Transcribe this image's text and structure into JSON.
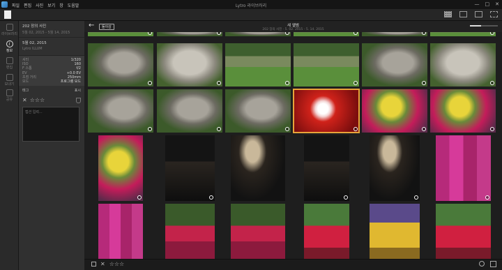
{
  "app": {
    "title": "Lytro 라이브러리",
    "menus": [
      "파일",
      "편집",
      "사진",
      "보기",
      "창",
      "도움말"
    ],
    "window_controls": [
      "—",
      "□",
      "✕"
    ]
  },
  "sidebar": {
    "tabs": [
      {
        "label": "라이브러리"
      },
      {
        "label": "정보"
      },
      {
        "label": "편집"
      },
      {
        "label": "보내기"
      },
      {
        "label": "공유"
      }
    ]
  },
  "album": {
    "title": "202 장의 사진",
    "date_range": "5월 02, 2015 - 5월 14, 2015"
  },
  "photo": {
    "date": "5월 02, 2015",
    "camera": "Lytro ILLUM"
  },
  "exif": [
    {
      "k": "셔터",
      "v": "1/320"
    },
    {
      "k": "ISO",
      "v": "160"
    },
    {
      "k": "F 스톱",
      "v": "f/2"
    },
    {
      "k": "EV",
      "v": "+0.0 EV"
    },
    {
      "k": "초점 거리",
      "v": "250mm"
    },
    {
      "k": "모드",
      "v": "프로그램 모드"
    }
  ],
  "tags": {
    "label": "태그",
    "action": "표시"
  },
  "rating": {
    "stars": 0,
    "max": 5
  },
  "caption": {
    "placeholder": "캡션 입력..."
  },
  "header": {
    "back_label": "←",
    "return_label": "돌아감",
    "title": "새 앨범",
    "subtitle": "202 장의 사진 · 5. 02. 2015 - 5. 14. 2015",
    "zoom": 0.4
  },
  "footer": {
    "stars": "☆☆☆"
  },
  "thumbs": [
    {
      "style": "g-yard",
      "info": true,
      "selected": false
    },
    {
      "style": "g-stone",
      "info": true,
      "selected": false
    },
    {
      "style": "g-stone",
      "info": true,
      "selected": false
    },
    {
      "style": "g-yard",
      "info": true,
      "selected": false
    },
    {
      "style": "g-stone",
      "info": true,
      "selected": false
    },
    {
      "style": "g-yard",
      "info": true,
      "selected": false
    },
    {
      "style": "g-stone",
      "info": true,
      "selected": false
    },
    {
      "style": "g-bigstone",
      "info": true,
      "selected": false
    },
    {
      "style": "g-yard",
      "info": true,
      "selected": false
    },
    {
      "style": "g-yard",
      "info": true,
      "selected": false
    },
    {
      "style": "g-stone",
      "info": true,
      "selected": false
    },
    {
      "style": "g-bigstone",
      "info": true,
      "selected": false
    },
    {
      "style": "g-stone",
      "info": true,
      "selected": false
    },
    {
      "style": "g-stone",
      "info": true,
      "selected": false
    },
    {
      "style": "g-stone",
      "info": true,
      "selected": false
    },
    {
      "style": "g-flower",
      "info": true,
      "selected": true
    },
    {
      "style": "g-redyellow",
      "info": true,
      "selected": false
    },
    {
      "style": "g-redyellow",
      "info": true,
      "selected": false
    },
    {
      "style": "g-redyellow",
      "info": true,
      "selected": false
    },
    {
      "style": "g-dark",
      "info": true,
      "selected": false
    },
    {
      "style": "g-window",
      "info": false,
      "selected": false
    },
    {
      "style": "g-dark",
      "info": true,
      "selected": false
    },
    {
      "style": "g-window",
      "info": true,
      "selected": false
    },
    {
      "style": "g-pink",
      "info": true,
      "selected": false
    },
    {
      "style": "g-pink",
      "info": false,
      "selected": false
    },
    {
      "style": "g-red",
      "info": true,
      "selected": false
    },
    {
      "style": "g-red",
      "info": false,
      "selected": false
    },
    {
      "style": "g-redgarden",
      "info": false,
      "selected": false
    },
    {
      "style": "g-dragon",
      "info": false,
      "selected": false
    },
    {
      "style": "g-redgarden",
      "info": false,
      "selected": false
    }
  ]
}
